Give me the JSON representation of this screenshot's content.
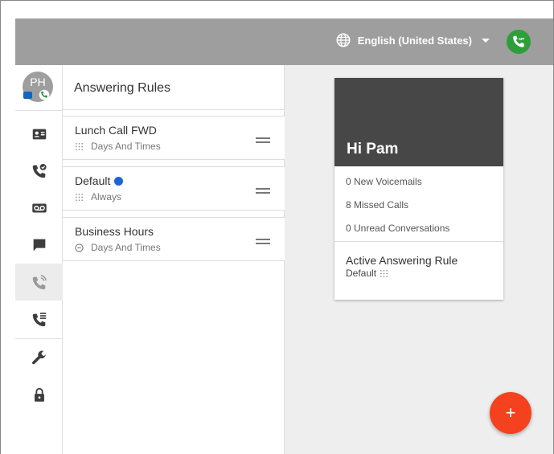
{
  "topbar": {
    "language": "English (United States)",
    "language_icon": "globe-icon",
    "sip_icon": "sip-phone-icon"
  },
  "user": {
    "initials": "PH"
  },
  "nav": [
    {
      "name": "contacts",
      "icon": "contact-card-icon"
    },
    {
      "name": "call-history",
      "icon": "phone-history-icon"
    },
    {
      "name": "voicemail",
      "icon": "voicemail-icon"
    },
    {
      "name": "messages",
      "icon": "chat-icon"
    },
    {
      "name": "answering-rules",
      "icon": "phone-ringing-icon",
      "active": true
    },
    {
      "name": "call-queues",
      "icon": "phone-queue-icon"
    },
    {
      "name": "settings",
      "icon": "wrench-icon"
    },
    {
      "name": "security",
      "icon": "lock-icon"
    }
  ],
  "panel": {
    "title": "Answering Rules",
    "rules": [
      {
        "name": "Lunch Call FWD",
        "sub": "Days And Times",
        "icon": "rules-icon"
      },
      {
        "name": "Default",
        "sub": "Always",
        "icon": "rules-icon",
        "active": true
      },
      {
        "name": "Business Hours",
        "sub": "Days And Times",
        "icon": "clock-icon"
      }
    ]
  },
  "card": {
    "greeting": "Hi Pam",
    "voicemails": "0 New Voicemails",
    "missed": "8 Missed Calls",
    "unread": "0 Unread Conversations",
    "active_label": "Active Answering Rule",
    "active_value": "Default"
  },
  "fab": {
    "label": "+"
  },
  "colors": {
    "topbar": "#9e9e9e",
    "accent_green": "#2e9e39",
    "active_dot": "#1a66d8",
    "fab": "#f4411e",
    "card_header": "#474747"
  }
}
